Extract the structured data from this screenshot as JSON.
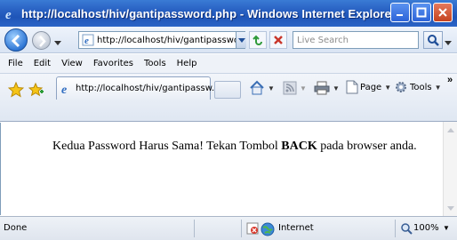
{
  "window": {
    "title": "http://localhost/hiv/gantipassword.php - Windows Internet Explorer"
  },
  "nav": {
    "address": "http://localhost/hiv/gantipassword.php",
    "search_placeholder": "Live Search"
  },
  "menu": {
    "items": [
      "File",
      "Edit",
      "View",
      "Favorites",
      "Tools",
      "Help"
    ]
  },
  "tabs": {
    "active_title": "http://localhost/hiv/gantipassw..."
  },
  "commands": {
    "page_label": "Page",
    "tools_label": "Tools",
    "more": "»"
  },
  "content": {
    "message_before": "Kedua Password Harus Sama! Tekan Tombol ",
    "message_bold": "BACK",
    "message_after": " pada browser anda."
  },
  "status": {
    "text": "Done",
    "zone": "Internet",
    "zoom": "100%"
  },
  "colors": {
    "titlebar": "#2a63c4",
    "close_button": "#c5431f"
  }
}
